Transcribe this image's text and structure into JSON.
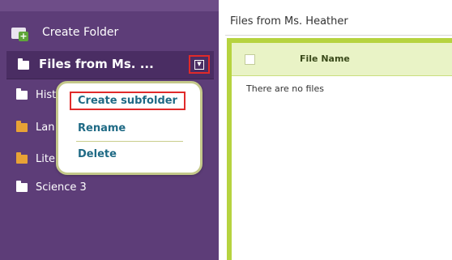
{
  "sidebar": {
    "create_folder_label": "Create Folder",
    "selected_folder": {
      "label": "Files from Ms. ...",
      "menu_button_icon": "dropdown-arrow-icon"
    },
    "folders": [
      {
        "label": "Hist",
        "icon": "folder-icon"
      },
      {
        "label": "Lan",
        "icon": "folder-icon"
      },
      {
        "label": "Lite",
        "icon": "folder-icon"
      },
      {
        "label": "Science 3",
        "icon": "folder-icon"
      }
    ]
  },
  "context_menu": {
    "items": [
      "Create subfolder",
      "Rename",
      "Delete"
    ]
  },
  "main": {
    "title": "Files from Ms. Heather",
    "table": {
      "columns": [
        "File Name"
      ],
      "empty_message": "There are no files"
    }
  },
  "colors": {
    "sidebar_bg": "#5d3d78",
    "selected_row_bg": "#4a2d63",
    "menu_text": "#1f6a85",
    "highlight_border": "#e02a2a",
    "frame_green": "#b6d33f"
  }
}
